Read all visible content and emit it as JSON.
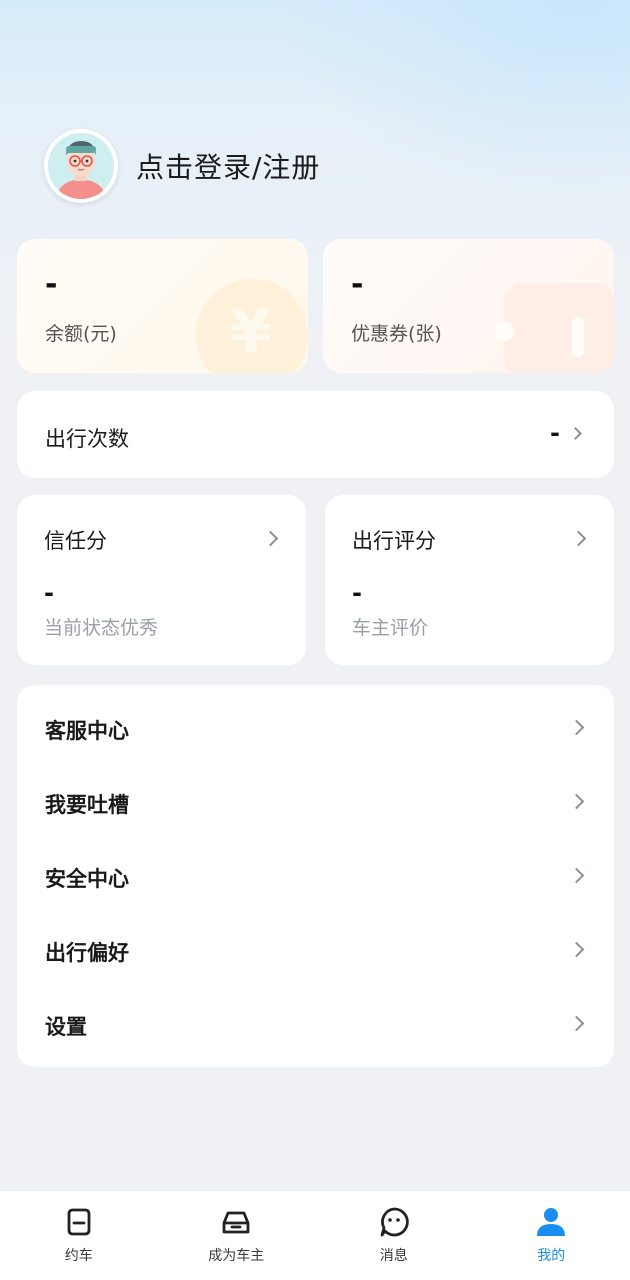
{
  "header": {
    "login_text": "点击登录/注册"
  },
  "stats": {
    "balance": {
      "value": "-",
      "label": "余额(元)"
    },
    "coupons": {
      "value": "-",
      "label": "优惠券(张)"
    }
  },
  "trips": {
    "label": "出行次数",
    "value": "-"
  },
  "scores": {
    "trust": {
      "title": "信任分",
      "value": "-",
      "sub": "当前状态优秀"
    },
    "rating": {
      "title": "出行评分",
      "value": "-",
      "sub": "车主评价"
    }
  },
  "menu": {
    "items": [
      {
        "label": "客服中心"
      },
      {
        "label": "我要吐槽"
      },
      {
        "label": "安全中心"
      },
      {
        "label": "出行偏好"
      },
      {
        "label": "设置"
      }
    ]
  },
  "tabs": [
    {
      "label": "约车",
      "icon": "car-booking-icon"
    },
    {
      "label": "成为车主",
      "icon": "car-icon"
    },
    {
      "label": "消息",
      "icon": "message-icon"
    },
    {
      "label": "我的",
      "icon": "user-icon",
      "active": true
    }
  ],
  "colors": {
    "accent": "#1a8df0",
    "background": "#eff1f5"
  }
}
